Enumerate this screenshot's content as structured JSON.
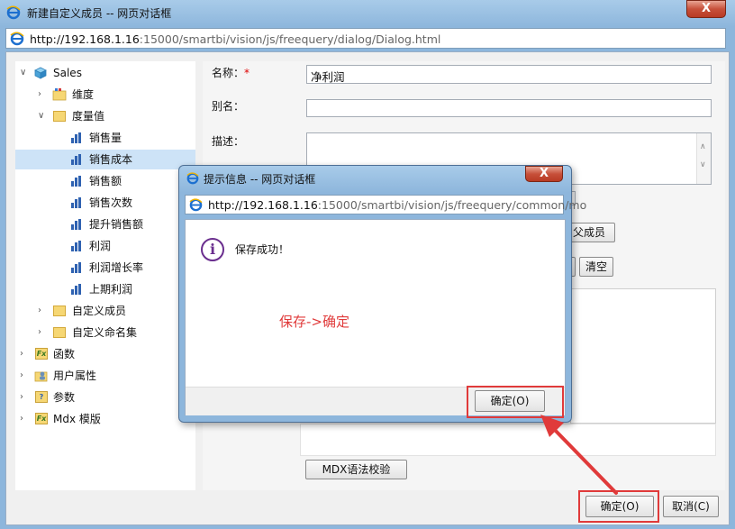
{
  "window": {
    "title": "新建自定义成员 -- 网页对话框",
    "close_label": "X",
    "address_host": "http://192.168.1.16",
    "address_rest": ":15000/smartbi/vision/js/freequery/dialog/Dialog.html"
  },
  "tree": {
    "root": "Sales",
    "items": [
      {
        "label": "维度"
      },
      {
        "label": "度量值"
      },
      {
        "label": "销售量"
      },
      {
        "label": "销售成本"
      },
      {
        "label": "销售额"
      },
      {
        "label": "销售次数"
      },
      {
        "label": "提升销售额"
      },
      {
        "label": "利润"
      },
      {
        "label": "利润增长率"
      },
      {
        "label": "上期利润"
      },
      {
        "label": "自定义成员"
      },
      {
        "label": "自定义命名集"
      },
      {
        "label": "函数"
      },
      {
        "label": "用户属性"
      },
      {
        "label": "参数"
      },
      {
        "label": "Mdx 模版"
      }
    ]
  },
  "form": {
    "name_label": "名称：",
    "name_required": "*",
    "name_value": "净利润",
    "alias_label": "别名：",
    "alias_value": "",
    "desc_label": "描述：",
    "parent_button": "父成员",
    "clear_button": "清空",
    "mdx_check_button": "MDX语法校验"
  },
  "footer": {
    "ok_button": "确定(O)",
    "cancel_button": "取消(C)"
  },
  "dialog": {
    "title": "提示信息 -- 网页对话框",
    "close_label": "X",
    "address_host": "http://192.168.1.16",
    "address_rest": ":15000/smartbi/vision/js/freequery/common/mo",
    "message": "保存成功！",
    "info_glyph": "i",
    "ok_button": "确定(O)"
  },
  "annotation": {
    "text": "保存->确定",
    "color": "#e03a3a"
  }
}
